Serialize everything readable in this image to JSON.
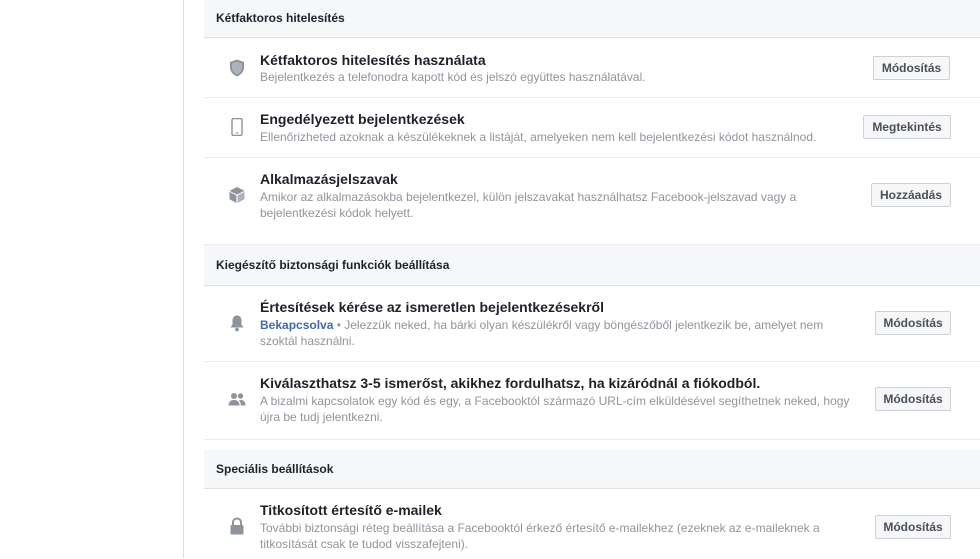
{
  "sections": [
    {
      "header": "Kétfaktoros hitelesítés",
      "rows": [
        {
          "title": "Kétfaktoros hitelesítés használata",
          "desc": "Bejelentkezés a telefonodra kapott kód és jelszó együttes használatával.",
          "button": "Módosítás",
          "icon": "shield-icon"
        },
        {
          "title": "Engedélyezett bejelentkezések",
          "desc": "Ellenőrizheted azoknak a készülékeknek a listáját, amelyeken nem kell bejelentkezési kódot használnod.",
          "button": "Megtekintés",
          "icon": "phone-icon"
        },
        {
          "title": "Alkalmazásjelszavak",
          "desc_line1": "Amikor az alkalmazásokba bejelentkezel, külön jelszavakat használhatsz Facebook-jelszavad vagy a",
          "desc_line2": "bejelentkezési kódok helyett.",
          "button": "Hozzáadás",
          "icon": "cube-icon"
        }
      ]
    },
    {
      "header": "Kiegészítő biztonsági funkciók beállítása",
      "rows": [
        {
          "title": "Értesítések kérése az ismeretlen bejelentkezésekről",
          "status": "Bekapcsolva",
          "desc_line1": " • Jelezzük neked, ha bárki olyan készülékről vagy böngészőből jelentkezik be, amelyet nem",
          "desc_line2": "szoktál használni.",
          "button": "Módosítás",
          "icon": "bell-icon"
        },
        {
          "title": "Kiválaszthatsz 3-5 ismerőst, akikhez fordulhatsz, ha kizáródnál a fiókodból.",
          "desc_line1": "A bizalmi kapcsolatok egy kód és egy, a Facebooktól származó URL-cím elküldésével segíthetnek neked, hogy",
          "desc_line2": "újra be tudj jelentkezni.",
          "button": "Módosítás",
          "icon": "friends-icon"
        }
      ]
    },
    {
      "header": "Speciális beállítások",
      "rows": [
        {
          "title": "Titkosított értesítő e-mailek",
          "desc_line1": "További biztonsági réteg beállítása a Facebooktól érkező értesítő e-mailekhez (ezeknek az e-maileknek a",
          "desc_line2": "titkosítását csak te tudod visszafejteni).",
          "button": "Módosítás",
          "icon": "lock-icon"
        }
      ]
    }
  ]
}
